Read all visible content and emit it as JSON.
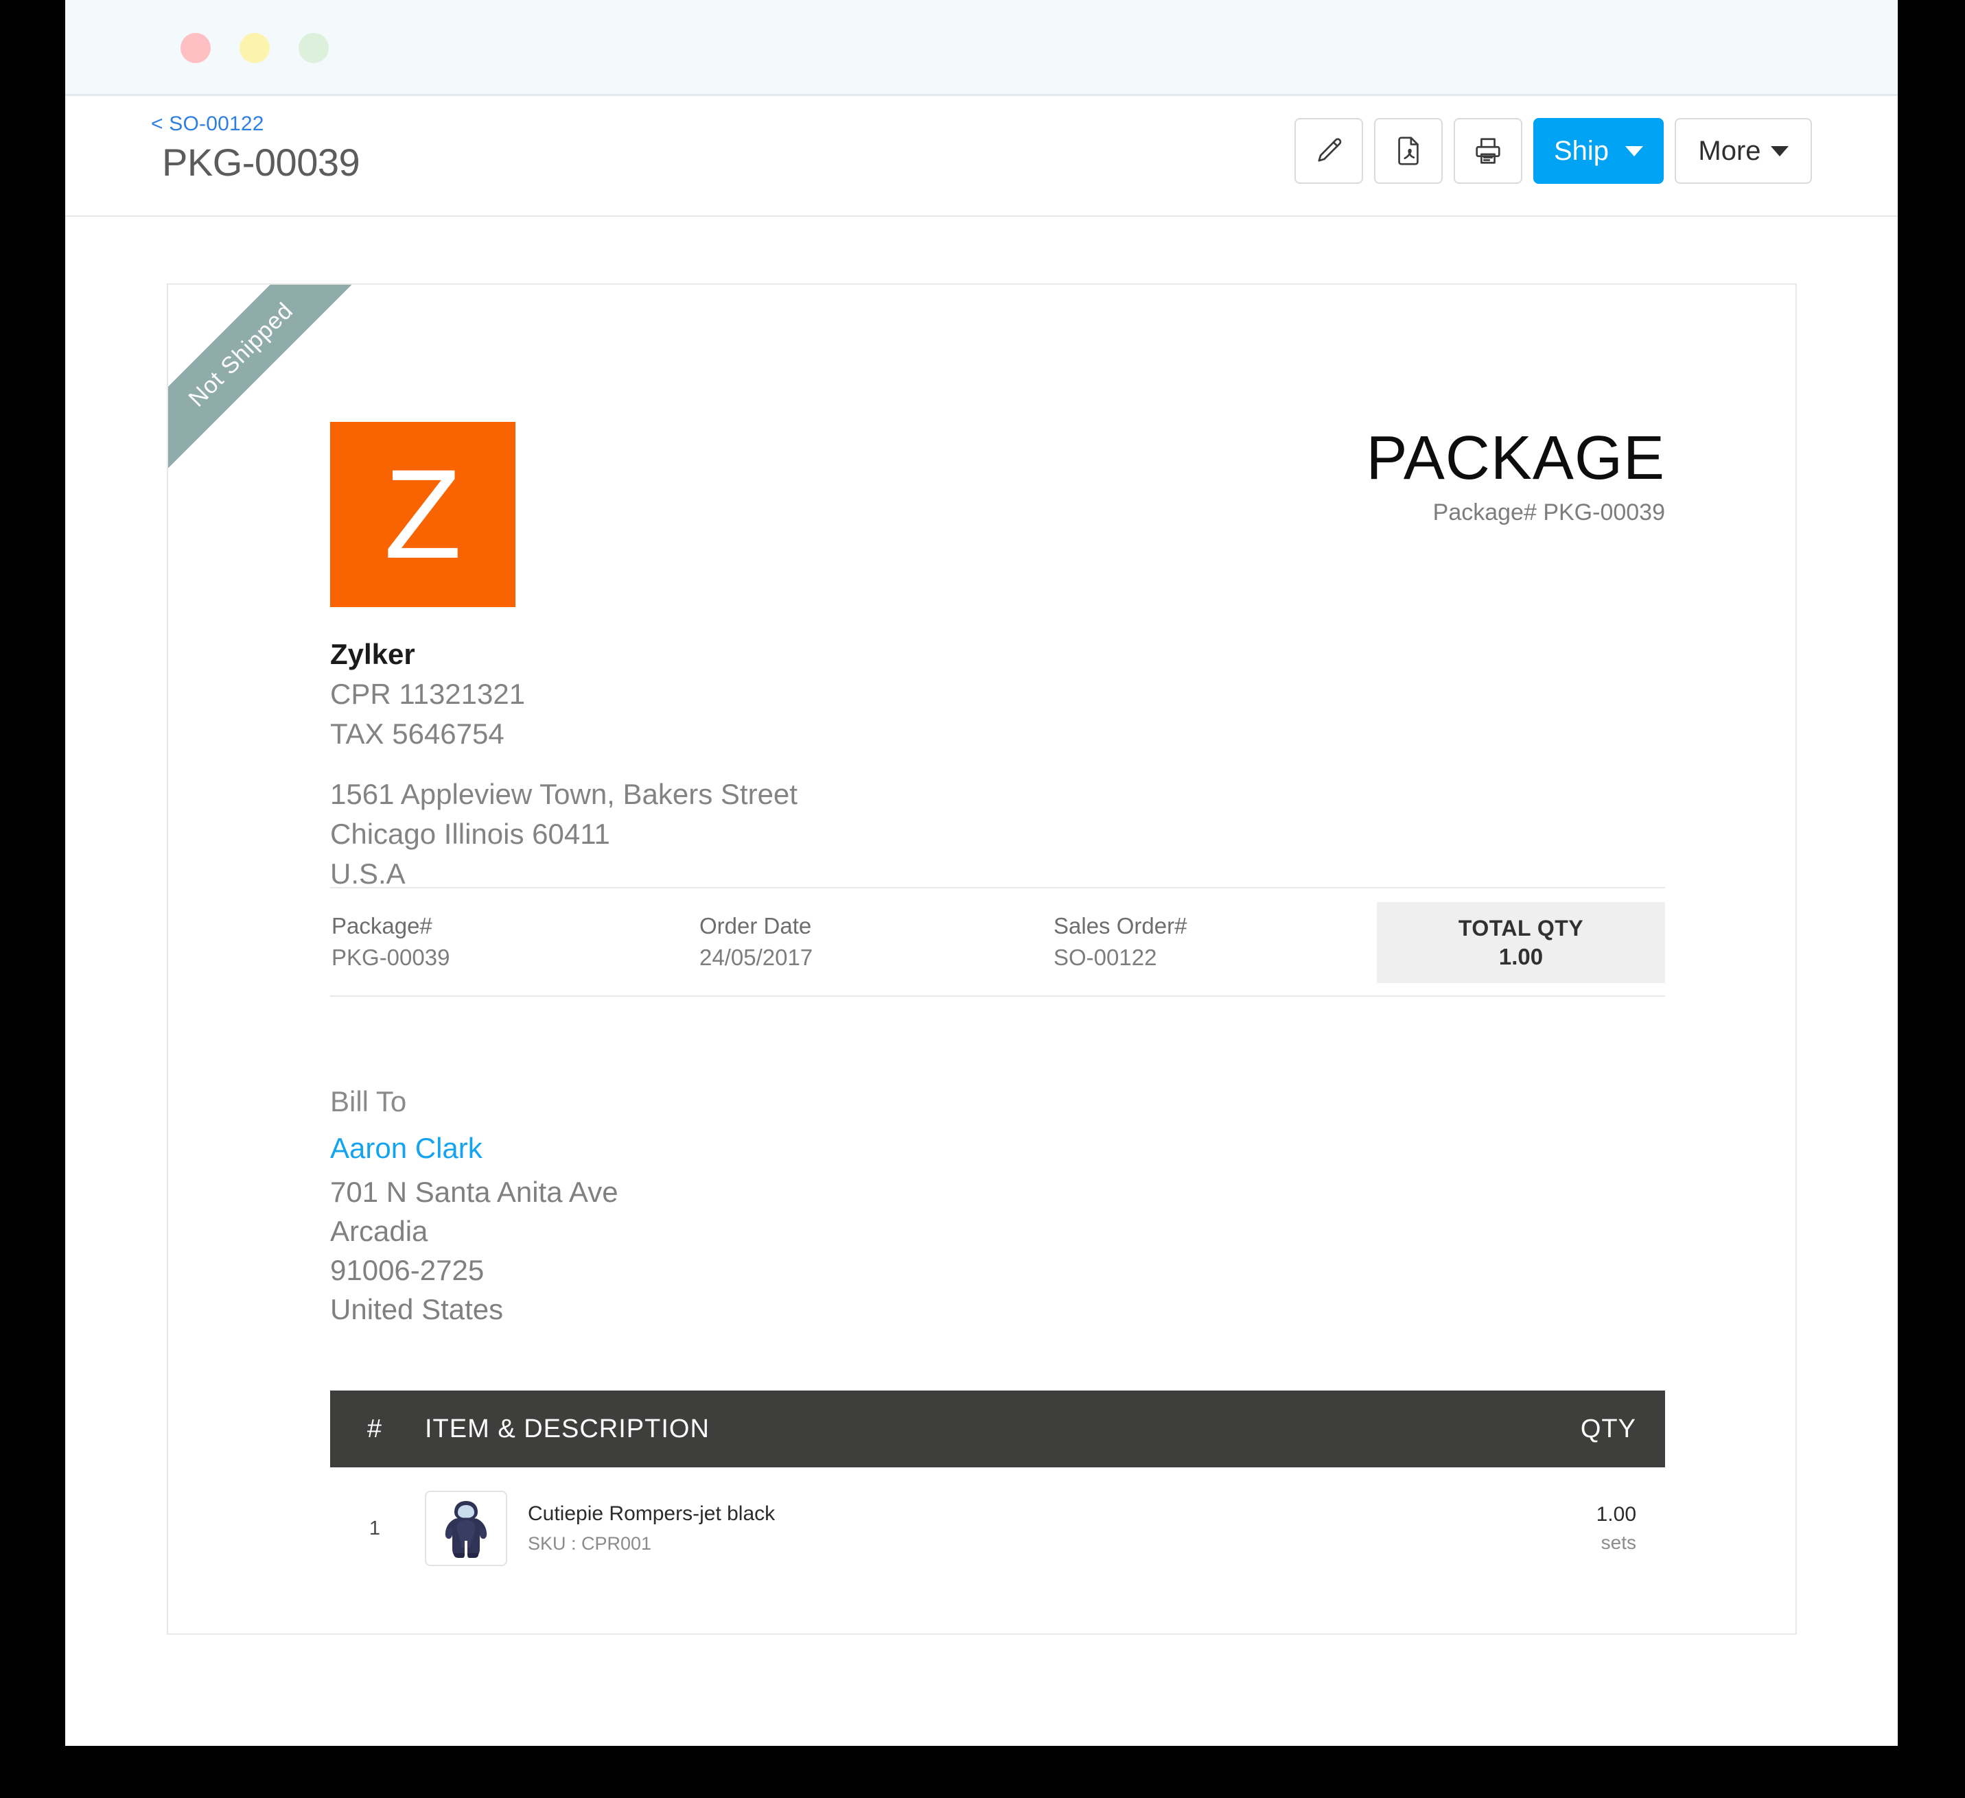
{
  "window": {
    "traffic_lights": [
      "close-red",
      "minimize-yellow",
      "maximize-green"
    ]
  },
  "header": {
    "breadcrumb": "< SO-00122",
    "title": "PKG-00039",
    "actions": [
      {
        "name": "edit-button",
        "icon": "pencil-icon",
        "label": ""
      },
      {
        "name": "pdf-button",
        "icon": "pdf-file-icon",
        "label": ""
      },
      {
        "name": "print-button",
        "icon": "printer-icon",
        "label": ""
      }
    ],
    "ship_label": "Ship",
    "more_label": "More"
  },
  "document": {
    "status_ribbon": "Not Shipped",
    "logo_letter": "Z",
    "title": "PACKAGE",
    "subtitle": "Package# PKG-00039",
    "company": {
      "name": "Zylker",
      "cpr": "CPR 11321321",
      "tax": "TAX 5646754",
      "address": [
        "1561 Appleview Town, Bakers Street",
        "Chicago Illinois 60411",
        "U.S.A"
      ]
    },
    "meta": [
      {
        "label": "Package#",
        "value": "PKG-00039"
      },
      {
        "label": "Order Date",
        "value": "24/05/2017"
      },
      {
        "label": "Sales Order#",
        "value": "SO-00122"
      }
    ],
    "total_qty": {
      "label": "TOTAL QTY",
      "value": "1.00"
    },
    "bill_to": {
      "label": "Bill To",
      "name": "Aaron Clark",
      "lines": [
        "701 N Santa Anita Ave",
        "Arcadia",
        "91006-2725",
        "United States"
      ]
    },
    "items_table": {
      "columns": [
        "#",
        "ITEM & DESCRIPTION",
        "QTY"
      ],
      "rows": [
        {
          "num": "1",
          "thumb": "baby-romper-thumbnail",
          "name": "Cutiepie Rompers-jet black",
          "sku": "SKU : CPR001",
          "qty": "1.00",
          "unit": "sets"
        }
      ]
    }
  },
  "colors": {
    "brand_orange": "#f96300",
    "accent_blue": "#00a3f3",
    "link_blue": "#14a3ee",
    "ribbon": "#8fabaa",
    "table_header": "#3e3e3c"
  }
}
